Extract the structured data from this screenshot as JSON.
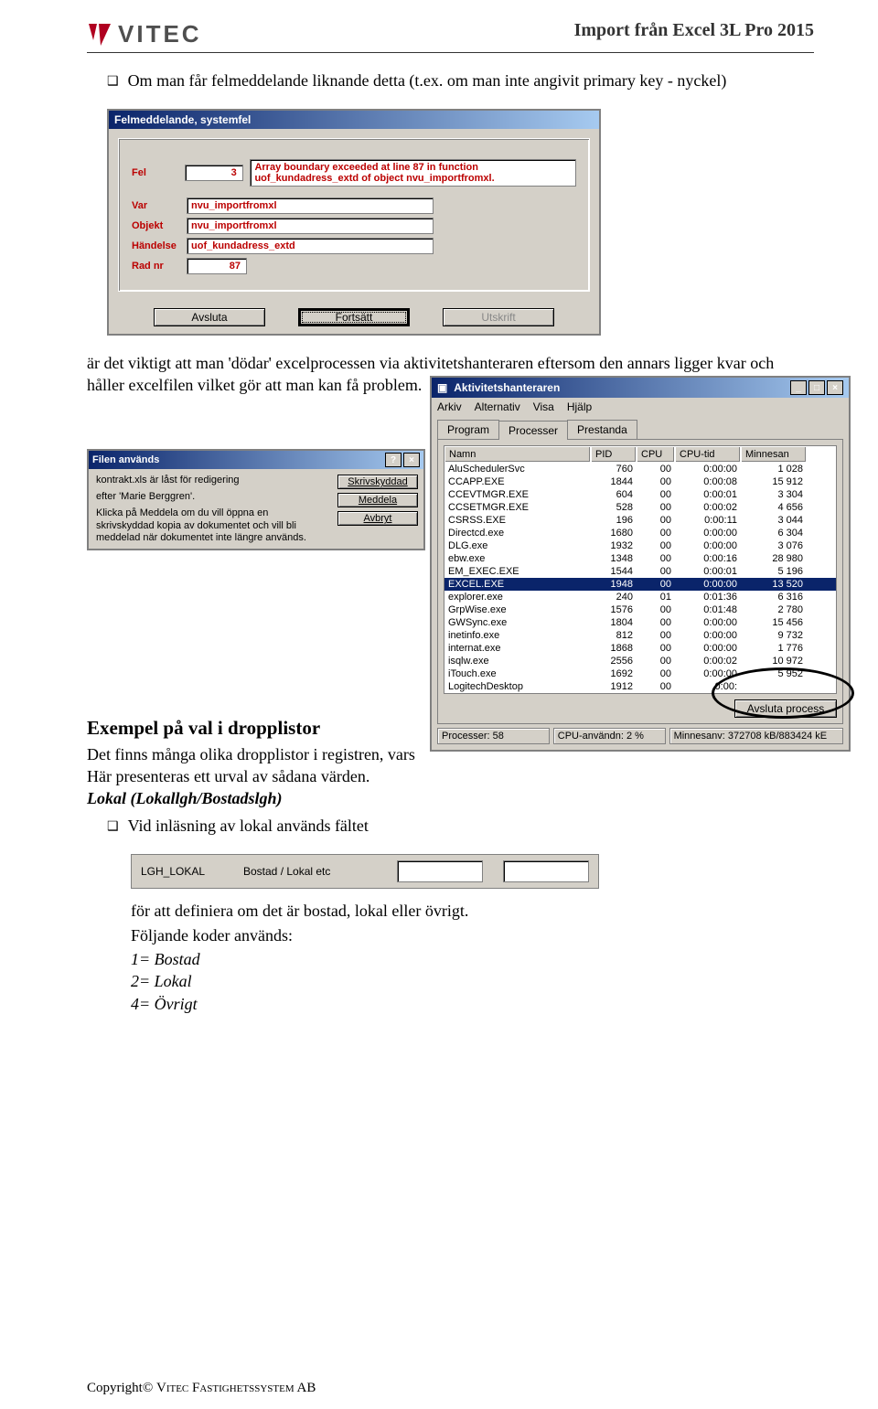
{
  "header": {
    "brand": "VITEC",
    "doc_title": "Import från Excel 3L Pro 2015"
  },
  "intro_bullet": "Om man får felmeddelande liknande detta (t.ex. om man inte angivit primary key - nyckel)",
  "error_dialog": {
    "title": "Felmeddelande, systemfel",
    "fields": {
      "fel_label": "Fel",
      "fel_code": "3",
      "fel_msg": "Array boundary exceeded at line 87 in function uof_kundadress_extd of object nvu_importfromxl.",
      "var_label": "Var",
      "var_val": "nvu_importfromxl",
      "objekt_label": "Objekt",
      "objekt_val": "nvu_importfromxl",
      "handelse_label": "Händelse",
      "handelse_val": "uof_kundadress_extd",
      "radnr_label": "Rad nr",
      "radnr_val": "87"
    },
    "buttons": {
      "avsluta": "Avsluta",
      "fortsatt": "Fortsätt",
      "utskrift": "Utskrift"
    }
  },
  "mid_para": "är det viktigt att man 'dödar' excelprocessen via aktivitetshanteraren eftersom den annars ligger kvar och håller excelfilen vilket gör att man kan få problem.",
  "file_in_use": {
    "title": "Filen används",
    "line1": "kontrakt.xls är låst för redigering",
    "line2": "efter 'Marie Berggren'.",
    "line3": "Klicka på Meddela om du vill öppna en skrivskyddad kopia av dokumentet och vill bli meddelad när dokumentet inte längre används.",
    "buttons": {
      "skriv": "Skrivskyddad",
      "meddela": "Meddela",
      "avbryt": "Avbryt"
    }
  },
  "taskmgr": {
    "title": "Aktivitetshanteraren",
    "menu": [
      "Arkiv",
      "Alternativ",
      "Visa",
      "Hjälp"
    ],
    "tabs": [
      "Program",
      "Processer",
      "Prestanda"
    ],
    "columns": [
      "Namn",
      "PID",
      "CPU",
      "CPU-tid",
      "Minnesan"
    ],
    "rows": [
      {
        "name": "AluSchedulerSvc",
        "pid": "760",
        "cpu": "00",
        "time": "0:00:00",
        "mem": "1 028"
      },
      {
        "name": "CCAPP.EXE",
        "pid": "1844",
        "cpu": "00",
        "time": "0:00:08",
        "mem": "15 912"
      },
      {
        "name": "CCEVTMGR.EXE",
        "pid": "604",
        "cpu": "00",
        "time": "0:00:01",
        "mem": "3 304"
      },
      {
        "name": "CCSETMGR.EXE",
        "pid": "528",
        "cpu": "00",
        "time": "0:00:02",
        "mem": "4 656"
      },
      {
        "name": "CSRSS.EXE",
        "pid": "196",
        "cpu": "00",
        "time": "0:00:11",
        "mem": "3 044"
      },
      {
        "name": "Directcd.exe",
        "pid": "1680",
        "cpu": "00",
        "time": "0:00:00",
        "mem": "6 304"
      },
      {
        "name": "DLG.exe",
        "pid": "1932",
        "cpu": "00",
        "time": "0:00:00",
        "mem": "3 076"
      },
      {
        "name": "ebw.exe",
        "pid": "1348",
        "cpu": "00",
        "time": "0:00:16",
        "mem": "28 980"
      },
      {
        "name": "EM_EXEC.EXE",
        "pid": "1544",
        "cpu": "00",
        "time": "0:00:01",
        "mem": "5 196"
      },
      {
        "name": "EXCEL.EXE",
        "pid": "1948",
        "cpu": "00",
        "time": "0:00:00",
        "mem": "13 520"
      },
      {
        "name": "explorer.exe",
        "pid": "240",
        "cpu": "01",
        "time": "0:01:36",
        "mem": "6 316"
      },
      {
        "name": "GrpWise.exe",
        "pid": "1576",
        "cpu": "00",
        "time": "0:01:48",
        "mem": "2 780"
      },
      {
        "name": "GWSync.exe",
        "pid": "1804",
        "cpu": "00",
        "time": "0:00:00",
        "mem": "15 456"
      },
      {
        "name": "inetinfo.exe",
        "pid": "812",
        "cpu": "00",
        "time": "0:00:00",
        "mem": "9 732"
      },
      {
        "name": "internat.exe",
        "pid": "1868",
        "cpu": "00",
        "time": "0:00:00",
        "mem": "1 776"
      },
      {
        "name": "isqlw.exe",
        "pid": "2556",
        "cpu": "00",
        "time": "0:00:02",
        "mem": "10 972"
      },
      {
        "name": "iTouch.exe",
        "pid": "1692",
        "cpu": "00",
        "time": "0:00:00",
        "mem": "5 952"
      },
      {
        "name": "LogitechDesktop",
        "pid": "1912",
        "cpu": "00",
        "time": "0:00:",
        "mem": ""
      }
    ],
    "end_process": "Avsluta process",
    "status": {
      "procs": "Processer: 58",
      "cpu": "CPU-användn: 2 %",
      "mem": "Minnesanv: 372708 kB/883424 kE"
    }
  },
  "section2": {
    "heading": "Exempel på val i dropplistor",
    "p1": "Det finns många olika dropplistor i registren, vars",
    "p2": "Här presenteras ett urval av sådana värden.",
    "sub": "Lokal (Lokallgh/Bostadslgh)",
    "bullet": "Vid inläsning av lokal används fältet",
    "lgh_label": "LGH_LOKAL",
    "lgh_desc": "Bostad / Lokal etc",
    "tail1": "för att definiera om det är bostad, lokal eller övrigt.",
    "tail2": "Följande koder används:",
    "codes": [
      "1= Bostad",
      "2= Lokal",
      "4= Övrigt"
    ]
  },
  "footer": "Copyright© VITEC FASTIGHETSSYSTEM AB"
}
